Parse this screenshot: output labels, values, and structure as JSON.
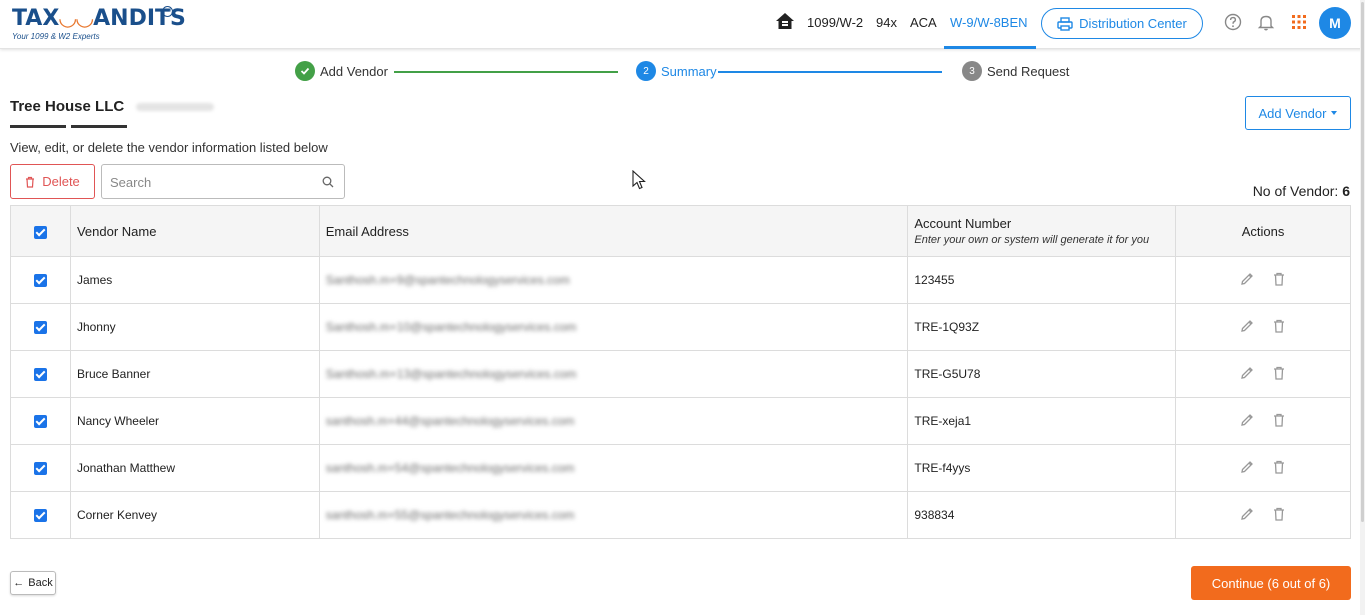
{
  "header": {
    "logo_text_left": "TAX",
    "logo_text_right": "ANDITS",
    "logo_tagline": "Your 1099 & W2 Experts",
    "nav": [
      {
        "label": "1099/W-2",
        "active": false
      },
      {
        "label": "94x",
        "active": false
      },
      {
        "label": "ACA",
        "active": false
      },
      {
        "label": "W-9/W-8BEN",
        "active": true
      }
    ],
    "distribution_center_label": "Distribution Center",
    "avatar_initial": "M"
  },
  "stepper": {
    "steps": [
      {
        "number": "1",
        "label": "Add Vendor",
        "state": "completed"
      },
      {
        "number": "2",
        "label": "Summary",
        "state": "active"
      },
      {
        "number": "3",
        "label": "Send Request",
        "state": "pending"
      }
    ]
  },
  "page": {
    "company_name": "Tree House LLC",
    "instruction": "View, edit, or delete the vendor information listed below",
    "add_vendor_label": "Add Vendor",
    "delete_label": "Delete",
    "search_placeholder": "Search",
    "vendor_count_label": "No of Vendor:",
    "vendor_count": "6"
  },
  "table": {
    "headers": {
      "vendor_name": "Vendor Name",
      "email": "Email Address",
      "account_number": "Account Number",
      "account_number_hint": "Enter your own or system will generate it for you",
      "actions": "Actions"
    },
    "rows": [
      {
        "name": "James",
        "email": "Santhosh.m+9@spantechnologyservices.com",
        "account": "123455",
        "checked": true
      },
      {
        "name": "Jhonny",
        "email": "Santhosh.m+10@spantechnologyservices.com",
        "account": "TRE-1Q93Z",
        "checked": true
      },
      {
        "name": "Bruce Banner",
        "email": "Santhosh.m+13@spantechnologyservices.com",
        "account": "TRE-G5U78",
        "checked": true
      },
      {
        "name": "Nancy Wheeler",
        "email": "santhosh.m+44@spantechnologyservices.com",
        "account": "TRE-xeja1",
        "checked": true
      },
      {
        "name": "Jonathan Matthew",
        "email": "santhosh.m+54@spantechnologyservices.com",
        "account": "TRE-f4yys",
        "checked": true
      },
      {
        "name": "Corner Kenvey",
        "email": "santhosh.m+55@spantechnologyservices.com",
        "account": "938834",
        "checked": true
      }
    ]
  },
  "footer": {
    "back_label": "Back",
    "continue_label": "Continue (6 out of 6)"
  },
  "colors": {
    "primary": "#1e88e5",
    "success": "#43a047",
    "danger": "#e05555",
    "continue": "#f26b1d"
  }
}
